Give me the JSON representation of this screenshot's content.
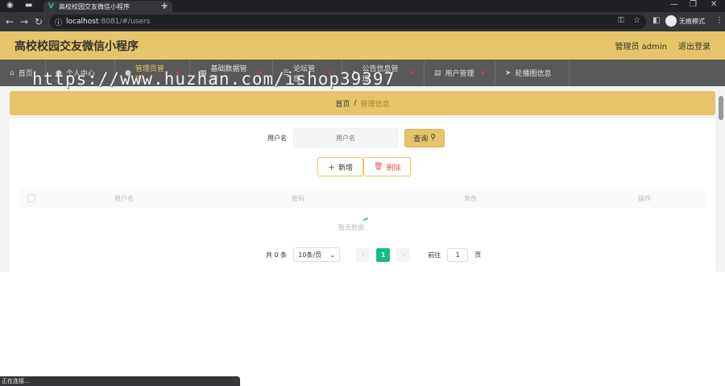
{
  "browser": {
    "tab_title": "高校校园交友微信小程序",
    "address": "localhost",
    "address_rest": ":8081/#/users",
    "incognito_label": "无痕模式"
  },
  "header": {
    "title": "高校校园交友微信小程序",
    "user_label": "管理员 admin",
    "logout_label": "退出登录"
  },
  "nav": {
    "items": [
      {
        "label": "首页",
        "icon": "home-icon"
      },
      {
        "label": "个人中心",
        "icon": "user-icon"
      },
      {
        "label": "管理员管理",
        "icon": "user-icon"
      },
      {
        "label": "基础数据管理",
        "icon": "grid-icon"
      },
      {
        "label": "论坛管理",
        "icon": "forum-icon"
      },
      {
        "label": "公告信息管理",
        "icon": "send-icon"
      },
      {
        "label": "用户管理",
        "icon": "doc-icon"
      },
      {
        "label": "轮播图信息",
        "icon": "send-icon"
      }
    ]
  },
  "breadcrumb": {
    "home": "首页",
    "separator": "/",
    "current": "管理信息"
  },
  "search": {
    "label": "用户名",
    "placeholder": "用户名",
    "button": "查询"
  },
  "actions": {
    "add": "新增",
    "delete": "删除"
  },
  "table": {
    "columns": [
      "用户名",
      "密码",
      "角色",
      "操作"
    ],
    "empty_text": "暂无数据"
  },
  "pager": {
    "total": "共 0 条",
    "page_size": "10条/页",
    "current_page": "1",
    "goto_label": "前往",
    "goto_value": "1",
    "page_unit": "页"
  },
  "watermark": "https://www.huzhan.com/ishop39397",
  "status_text": "正在连接..."
}
